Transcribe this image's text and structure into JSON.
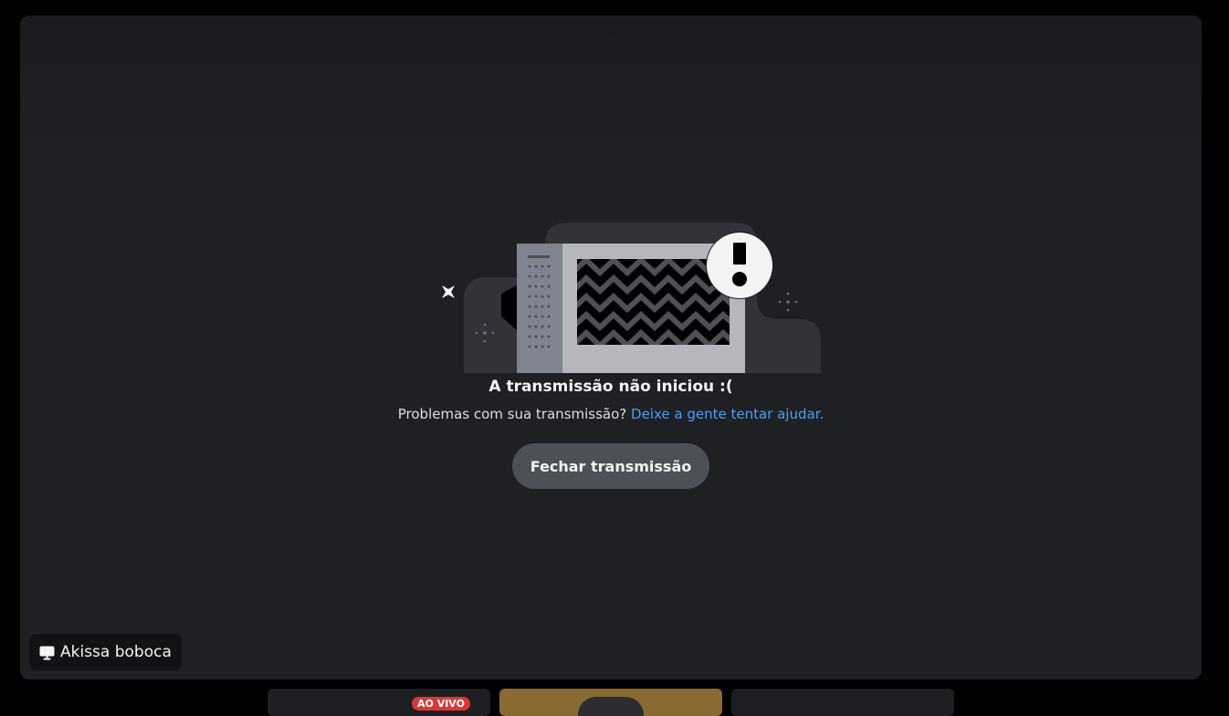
{
  "stream": {
    "title": "A transmissão não iniciou :(",
    "help_prefix": "Problemas com sua transmissão?",
    "help_link": "Deixe a gente tentar ajudar.",
    "close_button": "Fechar transmissão"
  },
  "streamer": {
    "icon": "screen-share-icon",
    "name": "Akissa boboca"
  },
  "thumbnails": [
    {
      "label": "",
      "badge": "AO VIVO"
    },
    {
      "label": ""
    },
    {
      "label": ""
    }
  ],
  "colors": {
    "background": "#1f2024",
    "link": "#4a9ef5",
    "button": "#4e5058",
    "live_badge": "#da373c"
  }
}
